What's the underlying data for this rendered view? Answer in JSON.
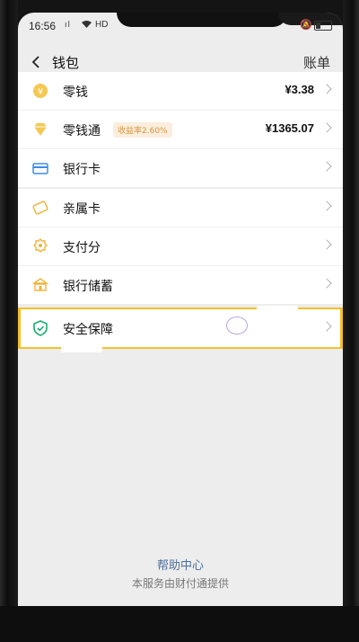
{
  "status": {
    "time": "16:56",
    "signal": "ıl",
    "network": "HD"
  },
  "nav": {
    "title": "钱包",
    "right": "账单"
  },
  "group1": [
    {
      "label": "零钱",
      "value": "¥3.38",
      "icon": "coin-icon"
    },
    {
      "label": "零钱通",
      "badge": "收益率2.60%",
      "value": "¥1365.07",
      "icon": "diamond-icon"
    },
    {
      "label": "银行卡",
      "icon": "bank-card-icon"
    }
  ],
  "group2": [
    {
      "label": "亲属卡",
      "icon": "family-card-icon"
    },
    {
      "label": "支付分",
      "icon": "payment-score-icon"
    },
    {
      "label": "银行储蓄",
      "icon": "bank-savings-icon"
    }
  ],
  "security": {
    "label": "安全保障",
    "icon": "shield-icon"
  },
  "footer": {
    "help": "帮助中心",
    "provider": "本服务由财付通提供"
  },
  "colors": {
    "accent_yellow": "#f5c02a",
    "icon_orange": "#f0b43a",
    "icon_blue": "#3b8ee6",
    "icon_green": "#1aad6f",
    "link": "#4d6e9a"
  }
}
